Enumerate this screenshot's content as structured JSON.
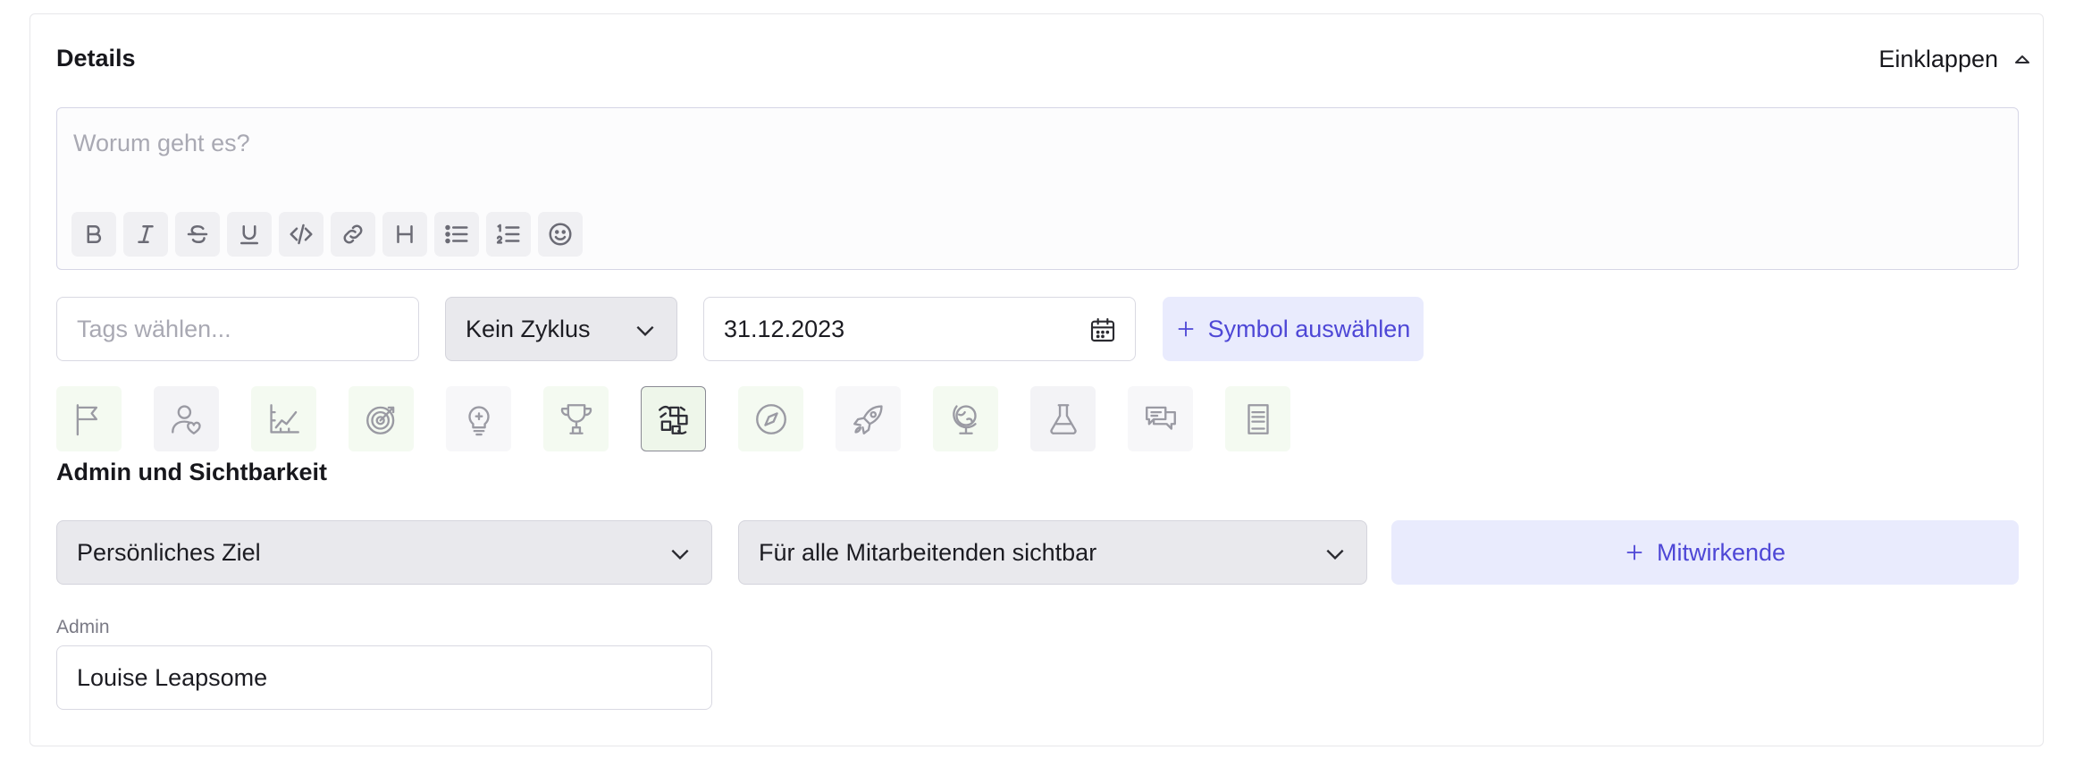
{
  "details": {
    "title": "Details",
    "collapse_label": "Einklappen",
    "editor_placeholder": "Worum geht es?",
    "toolbar": [
      {
        "name": "bold-icon",
        "glyph": "B"
      },
      {
        "name": "italic-icon",
        "glyph": "I"
      },
      {
        "name": "strikethrough-icon",
        "glyph": "S"
      },
      {
        "name": "underline-icon",
        "glyph": "U"
      },
      {
        "name": "code-icon"
      },
      {
        "name": "link-icon"
      },
      {
        "name": "heading-icon",
        "glyph": "H"
      },
      {
        "name": "bullet-list-icon"
      },
      {
        "name": "numbered-list-icon"
      },
      {
        "name": "emoji-icon"
      }
    ],
    "tags_placeholder": "Tags wählen...",
    "cycle_value": "Kein Zyklus",
    "date_value": "31.12.2023",
    "symbol_button_label": "Symbol auswählen",
    "symbols": [
      {
        "name": "flag-icon",
        "bg": "#f4faf1"
      },
      {
        "name": "user-heart-icon",
        "bg": "#f3f3f6"
      },
      {
        "name": "chart-icon",
        "bg": "#f4faf1"
      },
      {
        "name": "target-icon",
        "bg": "#f4faf1"
      },
      {
        "name": "lightbulb-icon",
        "bg": "#f7f7f9"
      },
      {
        "name": "trophy-icon",
        "bg": "#f4faf1"
      },
      {
        "name": "puzzle-icon",
        "bg": "#eef6ea",
        "selected": true
      },
      {
        "name": "compass-icon",
        "bg": "#f4faf1"
      },
      {
        "name": "rocket-icon",
        "bg": "#f7f7f9"
      },
      {
        "name": "globe-icon",
        "bg": "#f4faf1"
      },
      {
        "name": "flask-icon",
        "bg": "#f3f3f6"
      },
      {
        "name": "chat-icon",
        "bg": "#f7f7f9"
      },
      {
        "name": "book-icon",
        "bg": "#f4faf1"
      }
    ]
  },
  "admin_section": {
    "title": "Admin und Sichtbarkeit",
    "goal_type_value": "Persönliches Ziel",
    "visibility_value": "Für alle Mitarbeitenden sichtbar",
    "contributors_label": "Mitwirkende",
    "admin_label": "Admin",
    "admin_value": "Louise Leapsome"
  },
  "colors": {
    "accent": "#4e47d6",
    "accent_bg": "#e9ebfd",
    "select_bg": "#e9e9ed"
  }
}
